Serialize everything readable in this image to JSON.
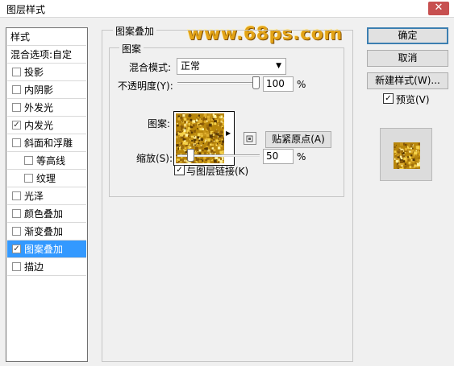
{
  "window": {
    "title": "图层样式",
    "close_glyph": "✕"
  },
  "watermark": "www.68ps.com",
  "style_list": {
    "header": "样式",
    "blend_options": "混合选项:自定",
    "items": [
      {
        "label": "投影",
        "checked": false,
        "selected": false,
        "indent": false
      },
      {
        "label": "内阴影",
        "checked": false,
        "selected": false,
        "indent": false
      },
      {
        "label": "外发光",
        "checked": false,
        "selected": false,
        "indent": false
      },
      {
        "label": "内发光",
        "checked": true,
        "selected": false,
        "indent": false
      },
      {
        "label": "斜面和浮雕",
        "checked": false,
        "selected": false,
        "indent": false
      },
      {
        "label": "等高线",
        "checked": false,
        "selected": false,
        "indent": true
      },
      {
        "label": "纹理",
        "checked": false,
        "selected": false,
        "indent": true
      },
      {
        "label": "光泽",
        "checked": false,
        "selected": false,
        "indent": false
      },
      {
        "label": "颜色叠加",
        "checked": false,
        "selected": false,
        "indent": false
      },
      {
        "label": "渐变叠加",
        "checked": false,
        "selected": false,
        "indent": false
      },
      {
        "label": "图案叠加",
        "checked": true,
        "selected": true,
        "indent": false
      },
      {
        "label": "描边",
        "checked": false,
        "selected": false,
        "indent": false
      }
    ]
  },
  "panel": {
    "outer_title": "图案叠加",
    "inner_title": "图案",
    "blend_mode_label": "混合模式:",
    "blend_mode_value": "正常",
    "opacity_label": "不透明度(Y):",
    "opacity_value": "100",
    "opacity_fraction": 1.0,
    "percent": "%",
    "pattern_label": "图案:",
    "snap_origin_button": "贴紧原点(A)",
    "scale_label": "缩放(S):",
    "scale_value": "50",
    "scale_fraction": 0.13,
    "link_label": "与图层链接(K)",
    "link_checked": true
  },
  "buttons": {
    "ok": "确定",
    "cancel": "取消",
    "new_style": "新建样式(W)...",
    "preview_label": "预览(V)",
    "preview_checked": true
  },
  "colors": {
    "selection": "#3399ff",
    "gold_dark": "#8a5a08",
    "gold_light": "#f5d24a",
    "watermark": "#e3a317"
  }
}
